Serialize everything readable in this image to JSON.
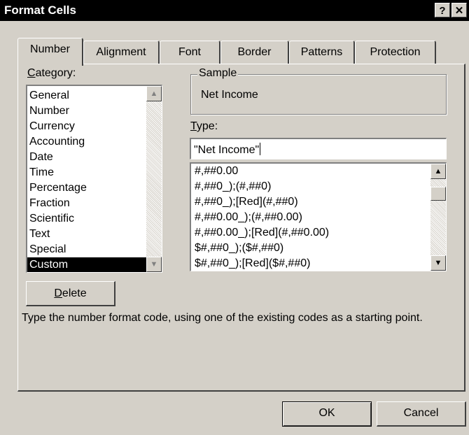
{
  "window": {
    "title": "Format Cells",
    "help_glyph": "?",
    "close_glyph": "✕"
  },
  "tabs": [
    {
      "label": "Number",
      "active": true
    },
    {
      "label": "Alignment"
    },
    {
      "label": "Font"
    },
    {
      "label": "Border"
    },
    {
      "label": "Patterns"
    },
    {
      "label": "Protection"
    }
  ],
  "category": {
    "label_first": "C",
    "label_rest": "ategory:",
    "items": [
      "General",
      "Number",
      "Currency",
      "Accounting",
      "Date",
      "Time",
      "Percentage",
      "Fraction",
      "Scientific",
      "Text",
      "Special",
      "Custom"
    ],
    "selected": "Custom"
  },
  "sample": {
    "label": "Sample",
    "value": "Net Income"
  },
  "type": {
    "label_first": "T",
    "label_rest": "ype:",
    "input_value": "\"Net Income\"",
    "codes": [
      "#,##0.00",
      "#,##0_);(#,##0)",
      "#,##0_);[Red](#,##0)",
      "#,##0.00_);(#,##0.00)",
      "#,##0.00_);[Red](#,##0.00)",
      "$#,##0_);($#,##0)",
      "$#,##0_);[Red]($#,##0)"
    ]
  },
  "delete_button": {
    "label_first": "D",
    "label_rest": "elete"
  },
  "hint": "Type the number format code, using one of the existing codes as a starting point.",
  "ok_label": "OK",
  "cancel_label": "Cancel",
  "scroll_up_glyph": "▲",
  "scroll_down_glyph": "▼"
}
